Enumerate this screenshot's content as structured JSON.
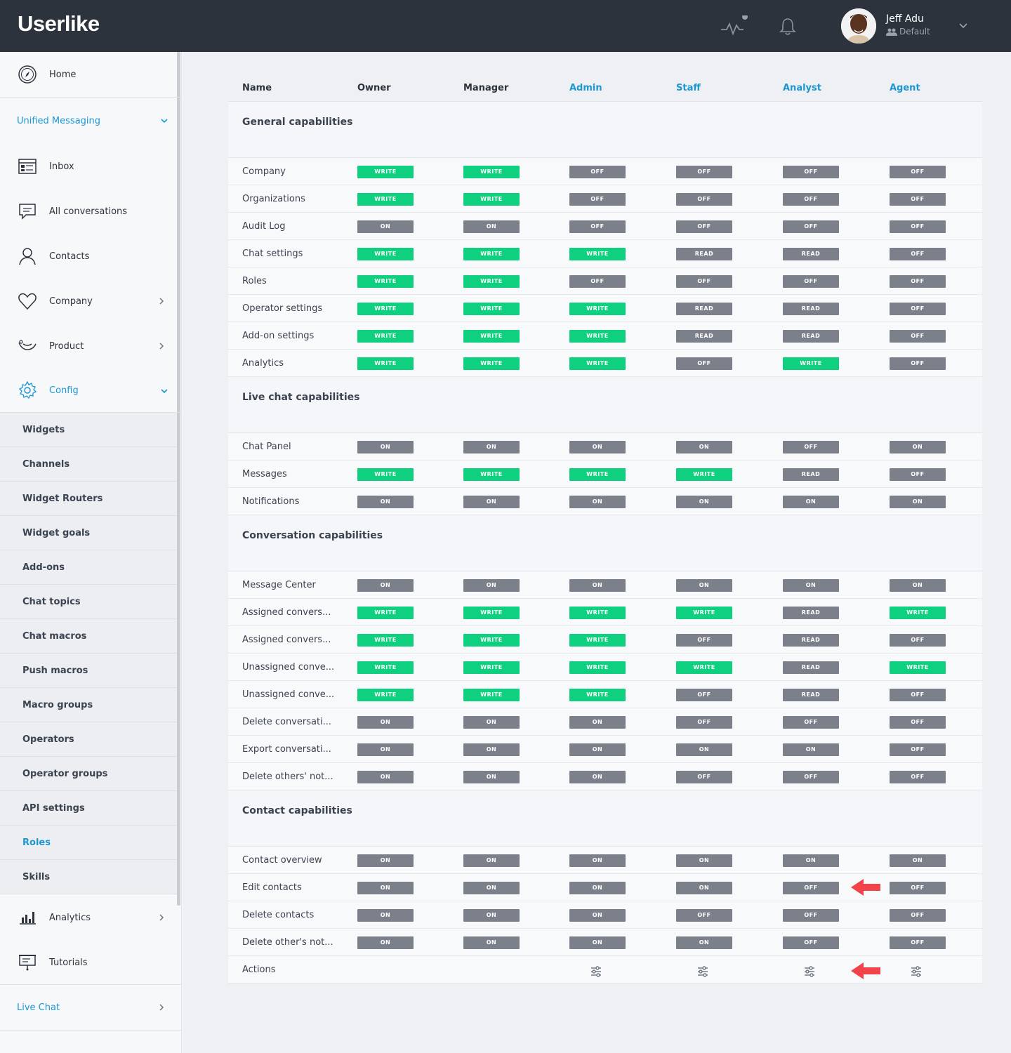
{
  "header": {
    "logo": "Userlike",
    "user_name": "Jeff Adu",
    "user_role": "Default"
  },
  "sidebar": {
    "home": "Home",
    "unified_messaging": "Unified Messaging",
    "inbox": "Inbox",
    "all_conversations": "All conversations",
    "contacts": "Contacts",
    "company": "Company",
    "product": "Product",
    "config": "Config",
    "sub_items": [
      "Widgets",
      "Channels",
      "Widget Routers",
      "Widget goals",
      "Add-ons",
      "Chat topics",
      "Chat macros",
      "Push macros",
      "Macro groups",
      "Operators",
      "Operator groups",
      "API settings",
      "Roles",
      "Skills"
    ],
    "active_sub": "Roles",
    "analytics": "Analytics",
    "tutorials": "Tutorials",
    "live_chat": "Live Chat"
  },
  "table": {
    "columns": [
      "Name",
      "Owner",
      "Manager",
      "Admin",
      "Staff",
      "Analyst",
      "Agent"
    ],
    "sections": [
      {
        "title": "General capabilities",
        "rows": [
          {
            "name": "Company",
            "values": [
              "WRITE",
              "WRITE",
              "OFF",
              "OFF",
              "OFF",
              "OFF"
            ]
          },
          {
            "name": "Organizations",
            "values": [
              "WRITE",
              "WRITE",
              "OFF",
              "OFF",
              "OFF",
              "OFF"
            ]
          },
          {
            "name": "Audit Log",
            "values": [
              "ON",
              "ON",
              "OFF",
              "OFF",
              "OFF",
              "OFF"
            ]
          },
          {
            "name": "Chat settings",
            "values": [
              "WRITE",
              "WRITE",
              "WRITE",
              "READ",
              "READ",
              "OFF"
            ]
          },
          {
            "name": "Roles",
            "values": [
              "WRITE",
              "WRITE",
              "OFF",
              "OFF",
              "OFF",
              "OFF"
            ]
          },
          {
            "name": "Operator settings",
            "values": [
              "WRITE",
              "WRITE",
              "WRITE",
              "READ",
              "READ",
              "OFF"
            ]
          },
          {
            "name": "Add-on settings",
            "values": [
              "WRITE",
              "WRITE",
              "WRITE",
              "READ",
              "READ",
              "OFF"
            ]
          },
          {
            "name": "Analytics",
            "values": [
              "WRITE",
              "WRITE",
              "WRITE",
              "OFF",
              "WRITE",
              "OFF"
            ]
          }
        ]
      },
      {
        "title": "Live chat capabilities",
        "rows": [
          {
            "name": "Chat Panel",
            "values": [
              "ON",
              "ON",
              "ON",
              "ON",
              "OFF",
              "ON"
            ]
          },
          {
            "name": "Messages",
            "values": [
              "WRITE",
              "WRITE",
              "WRITE",
              "WRITE",
              "READ",
              "OFF"
            ]
          },
          {
            "name": "Notifications",
            "values": [
              "ON",
              "ON",
              "ON",
              "ON",
              "ON",
              "ON"
            ]
          }
        ]
      },
      {
        "title": "Conversation capabilities",
        "rows": [
          {
            "name": "Message Center",
            "values": [
              "ON",
              "ON",
              "ON",
              "ON",
              "ON",
              "ON"
            ]
          },
          {
            "name": "Assigned convers...",
            "values": [
              "WRITE",
              "WRITE",
              "WRITE",
              "WRITE",
              "READ",
              "WRITE"
            ]
          },
          {
            "name": "Assigned convers...",
            "values": [
              "WRITE",
              "WRITE",
              "WRITE",
              "OFF",
              "READ",
              "OFF"
            ]
          },
          {
            "name": "Unassigned conve...",
            "values": [
              "WRITE",
              "WRITE",
              "WRITE",
              "WRITE",
              "READ",
              "WRITE"
            ]
          },
          {
            "name": "Unassigned conve...",
            "values": [
              "WRITE",
              "WRITE",
              "WRITE",
              "OFF",
              "READ",
              "OFF"
            ]
          },
          {
            "name": "Delete conversati...",
            "values": [
              "ON",
              "ON",
              "ON",
              "OFF",
              "OFF",
              "OFF"
            ]
          },
          {
            "name": "Export conversati...",
            "values": [
              "ON",
              "ON",
              "ON",
              "ON",
              "ON",
              "OFF"
            ]
          },
          {
            "name": "Delete others' not...",
            "values": [
              "ON",
              "ON",
              "ON",
              "OFF",
              "OFF",
              "OFF"
            ]
          }
        ]
      },
      {
        "title": "Contact capabilities",
        "rows": [
          {
            "name": "Contact overview",
            "values": [
              "ON",
              "ON",
              "ON",
              "ON",
              "ON",
              "ON"
            ]
          },
          {
            "name": "Edit contacts",
            "values": [
              "ON",
              "ON",
              "ON",
              "ON",
              "OFF",
              "OFF"
            ]
          },
          {
            "name": "Delete contacts",
            "values": [
              "ON",
              "ON",
              "ON",
              "OFF",
              "OFF",
              "OFF"
            ]
          },
          {
            "name": "Delete other's not...",
            "values": [
              "ON",
              "ON",
              "ON",
              "ON",
              "OFF",
              "OFF"
            ]
          }
        ]
      }
    ],
    "actions_label": "Actions"
  },
  "colors": {
    "accent": "#1c97d1",
    "write": "#0fd07e",
    "neutral_badge": "#7b808a",
    "annotation_arrow": "#f0444a"
  }
}
